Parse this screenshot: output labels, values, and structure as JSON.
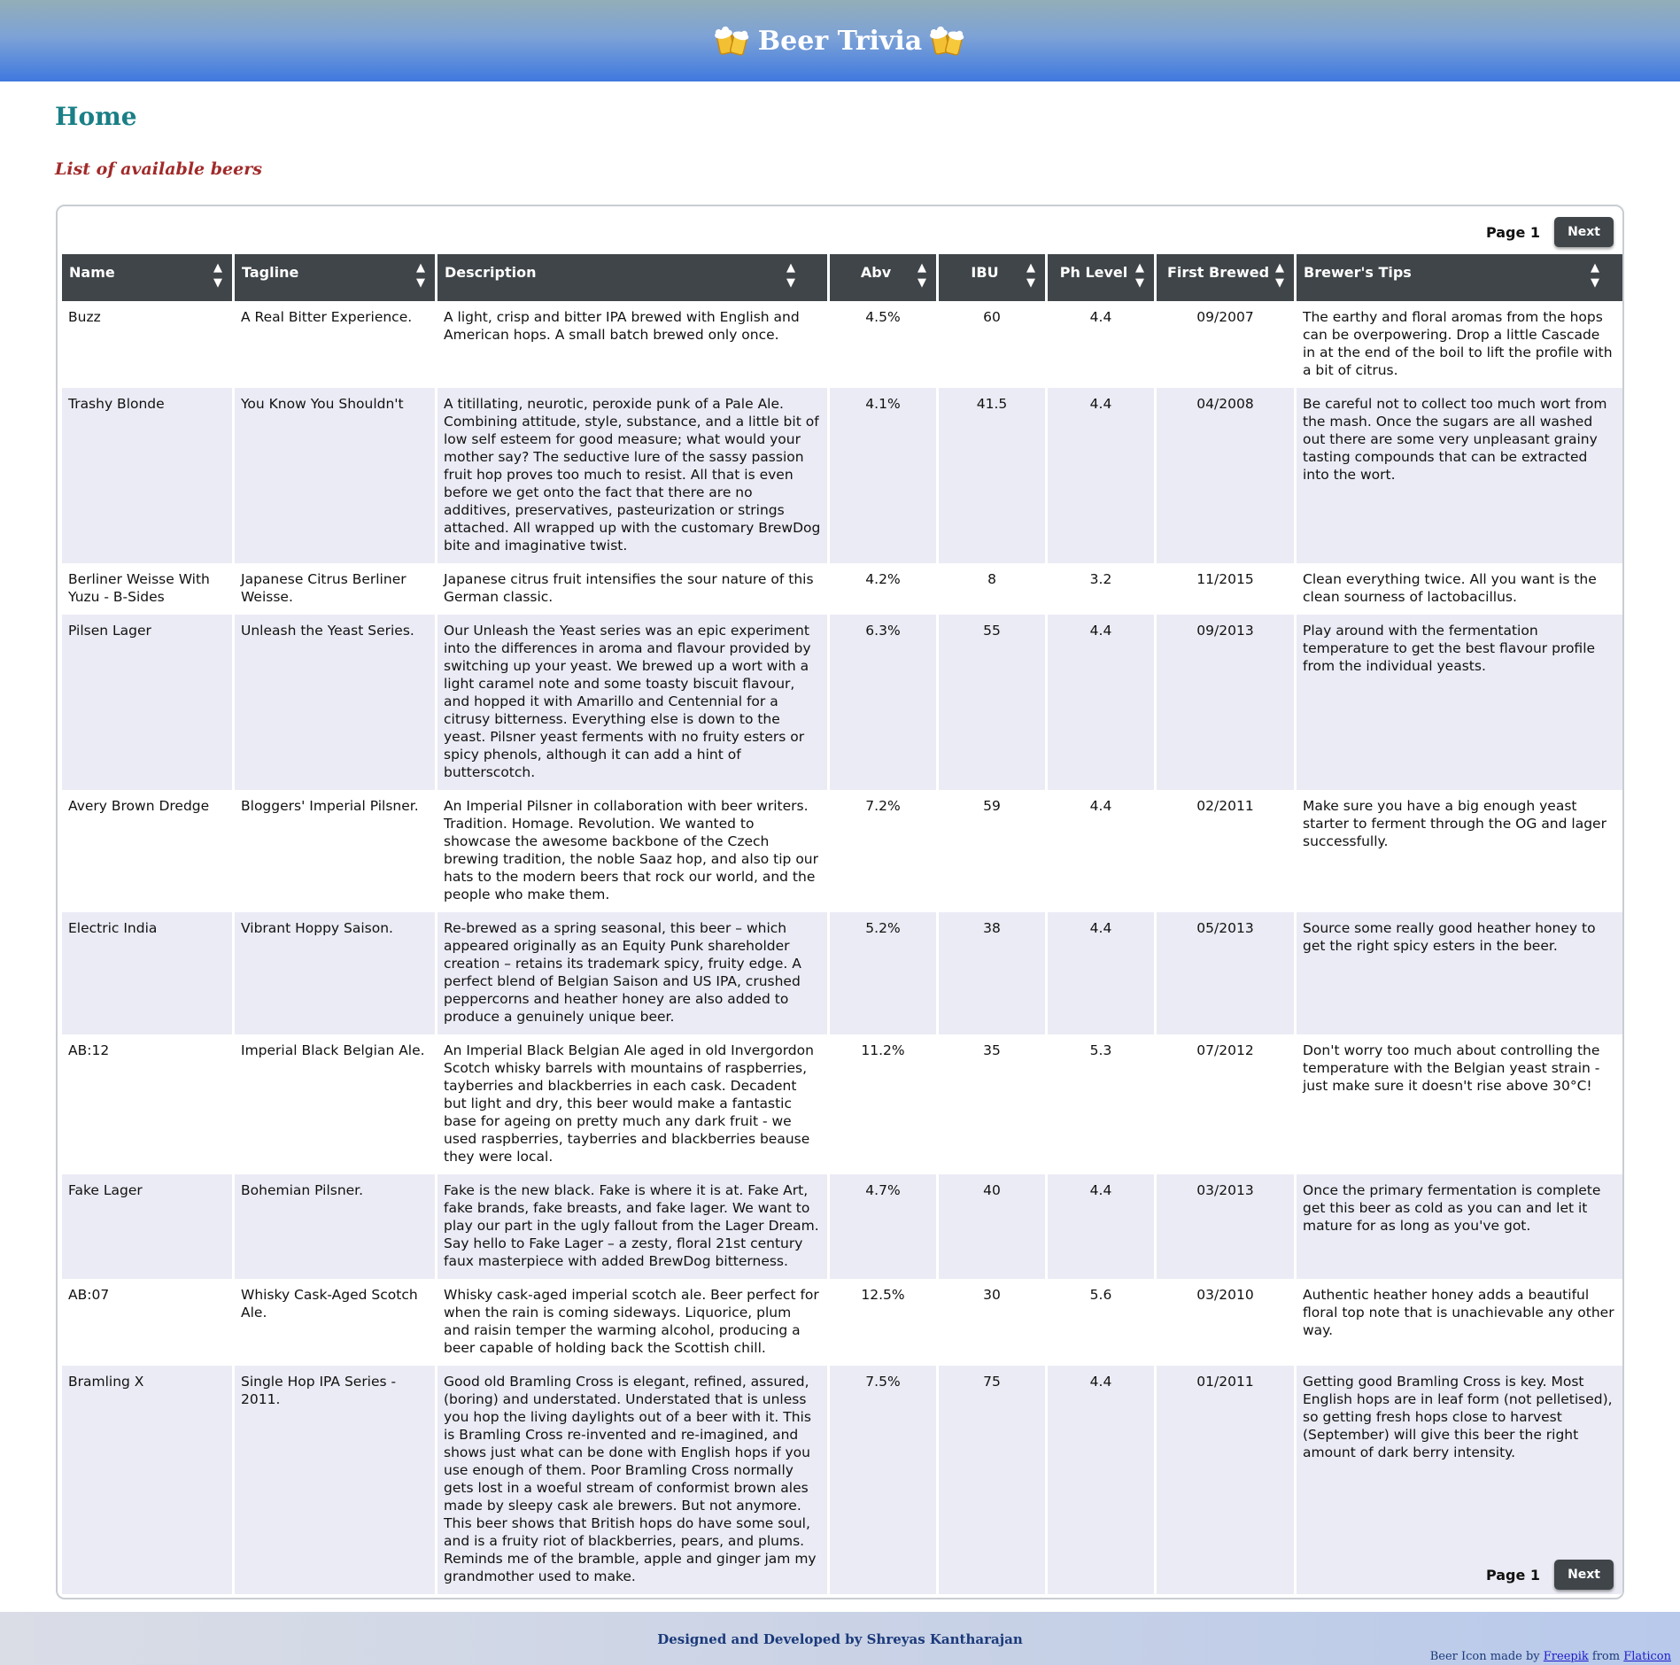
{
  "header": {
    "title": "Beer Trivia",
    "icon": "beer-mugs-icon"
  },
  "page": {
    "title": "Home",
    "subtitle": "List of available beers"
  },
  "pager": {
    "page_label": "Page 1",
    "next_label": "Next"
  },
  "table": {
    "columns": [
      "Name",
      "Tagline",
      "Description",
      "Abv",
      "IBU",
      "Ph Level",
      "First Brewed",
      "Brewer's Tips"
    ],
    "sort_up": "▲",
    "sort_down": "▼",
    "rows": [
      [
        "Buzz",
        "A Real Bitter Experience.",
        "A light, crisp and bitter IPA brewed with English and American hops. A small batch brewed only once.",
        "4.5%",
        "60",
        "4.4",
        "09/2007",
        "The earthy and floral aromas from the hops can be overpowering. Drop a little Cascade in at the end of the boil to lift the profile with a bit of citrus."
      ],
      [
        "Trashy Blonde",
        "You Know You Shouldn't",
        "A titillating, neurotic, peroxide punk of a Pale Ale. Combining attitude, style, substance, and a little bit of low self esteem for good measure; what would your mother say? The seductive lure of the sassy passion fruit hop proves too much to resist. All that is even before we get onto the fact that there are no additives, preservatives, pasteurization or strings attached. All wrapped up with the customary BrewDog bite and imaginative twist.",
        "4.1%",
        "41.5",
        "4.4",
        "04/2008",
        "Be careful not to collect too much wort from the mash. Once the sugars are all washed out there are some very unpleasant grainy tasting compounds that can be extracted into the wort."
      ],
      [
        "Berliner Weisse With Yuzu - B-Sides",
        "Japanese Citrus Berliner Weisse.",
        "Japanese citrus fruit intensifies the sour nature of this German classic.",
        "4.2%",
        "8",
        "3.2",
        "11/2015",
        "Clean everything twice. All you want is the clean sourness of lactobacillus."
      ],
      [
        "Pilsen Lager",
        "Unleash the Yeast Series.",
        "Our Unleash the Yeast series was an epic experiment into the differences in aroma and flavour provided by switching up your yeast. We brewed up a wort with a light caramel note and some toasty biscuit flavour, and hopped it with Amarillo and Centennial for a citrusy bitterness. Everything else is down to the yeast. Pilsner yeast ferments with no fruity esters or spicy phenols, although it can add a hint of butterscotch.",
        "6.3%",
        "55",
        "4.4",
        "09/2013",
        "Play around with the fermentation temperature to get the best flavour profile from the individual yeasts."
      ],
      [
        "Avery Brown Dredge",
        "Bloggers' Imperial Pilsner.",
        "An Imperial Pilsner in collaboration with beer writers. Tradition. Homage. Revolution. We wanted to showcase the awesome backbone of the Czech brewing tradition, the noble Saaz hop, and also tip our hats to the modern beers that rock our world, and the people who make them.",
        "7.2%",
        "59",
        "4.4",
        "02/2011",
        "Make sure you have a big enough yeast starter to ferment through the OG and lager successfully."
      ],
      [
        "Electric India",
        "Vibrant Hoppy Saison.",
        "Re-brewed as a spring seasonal, this beer – which appeared originally as an Equity Punk shareholder creation – retains its trademark spicy, fruity edge. A perfect blend of Belgian Saison and US IPA, crushed peppercorns and heather honey are also added to produce a genuinely unique beer.",
        "5.2%",
        "38",
        "4.4",
        "05/2013",
        "Source some really good heather honey to get the right spicy esters in the beer."
      ],
      [
        "AB:12",
        "Imperial Black Belgian Ale.",
        "An Imperial Black Belgian Ale aged in old Invergordon Scotch whisky barrels with mountains of raspberries, tayberries and blackberries in each cask. Decadent but light and dry, this beer would make a fantastic base for ageing on pretty much any dark fruit - we used raspberries, tayberries and blackberries beause they were local.",
        "11.2%",
        "35",
        "5.3",
        "07/2012",
        "Don't worry too much about controlling the temperature with the Belgian yeast strain - just make sure it doesn't rise above 30°C!"
      ],
      [
        "Fake Lager",
        "Bohemian Pilsner.",
        "Fake is the new black. Fake is where it is at. Fake Art, fake brands, fake breasts, and fake lager. We want to play our part in the ugly fallout from the Lager Dream. Say hello to Fake Lager – a zesty, floral 21st century faux masterpiece with added BrewDog bitterness.",
        "4.7%",
        "40",
        "4.4",
        "03/2013",
        "Once the primary fermentation is complete get this beer as cold as you can and let it mature for as long as you've got."
      ],
      [
        "AB:07",
        "Whisky Cask-Aged Scotch Ale.",
        "Whisky cask-aged imperial scotch ale. Beer perfect for when the rain is coming sideways. Liquorice, plum and raisin temper the warming alcohol, producing a beer capable of holding back the Scottish chill.",
        "12.5%",
        "30",
        "5.6",
        "03/2010",
        "Authentic heather honey adds a beautiful floral top note that is unachievable any other way."
      ],
      [
        "Bramling X",
        "Single Hop IPA Series - 2011.",
        "Good old Bramling Cross is elegant, refined, assured, (boring) and understated. Understated that is unless you hop the living daylights out of a beer with it. This is Bramling Cross re-invented and re-imagined, and shows just what can be done with English hops if you use enough of them. Poor Bramling Cross normally gets lost in a woeful stream of conformist brown ales made by sleepy cask ale brewers. But not anymore. This beer shows that British hops do have some soul, and is a fruity riot of blackberries, pears, and plums. Reminds me of the bramble, apple and ginger jam my grandmother used to make.",
        "7.5%",
        "75",
        "4.4",
        "01/2011",
        "Getting good Bramling Cross is key. Most English hops are in leaf form (not pelletised), so getting fresh hops close to harvest (September) will give this beer the right amount of dark berry intensity."
      ]
    ]
  },
  "footer": {
    "credit": "Designed and Developed by Shreyas Kantharajan",
    "attr_prefix": "Beer Icon made by ",
    "attr_link1": "Freepik",
    "attr_mid": " from ",
    "attr_link2": "Flaticon"
  }
}
